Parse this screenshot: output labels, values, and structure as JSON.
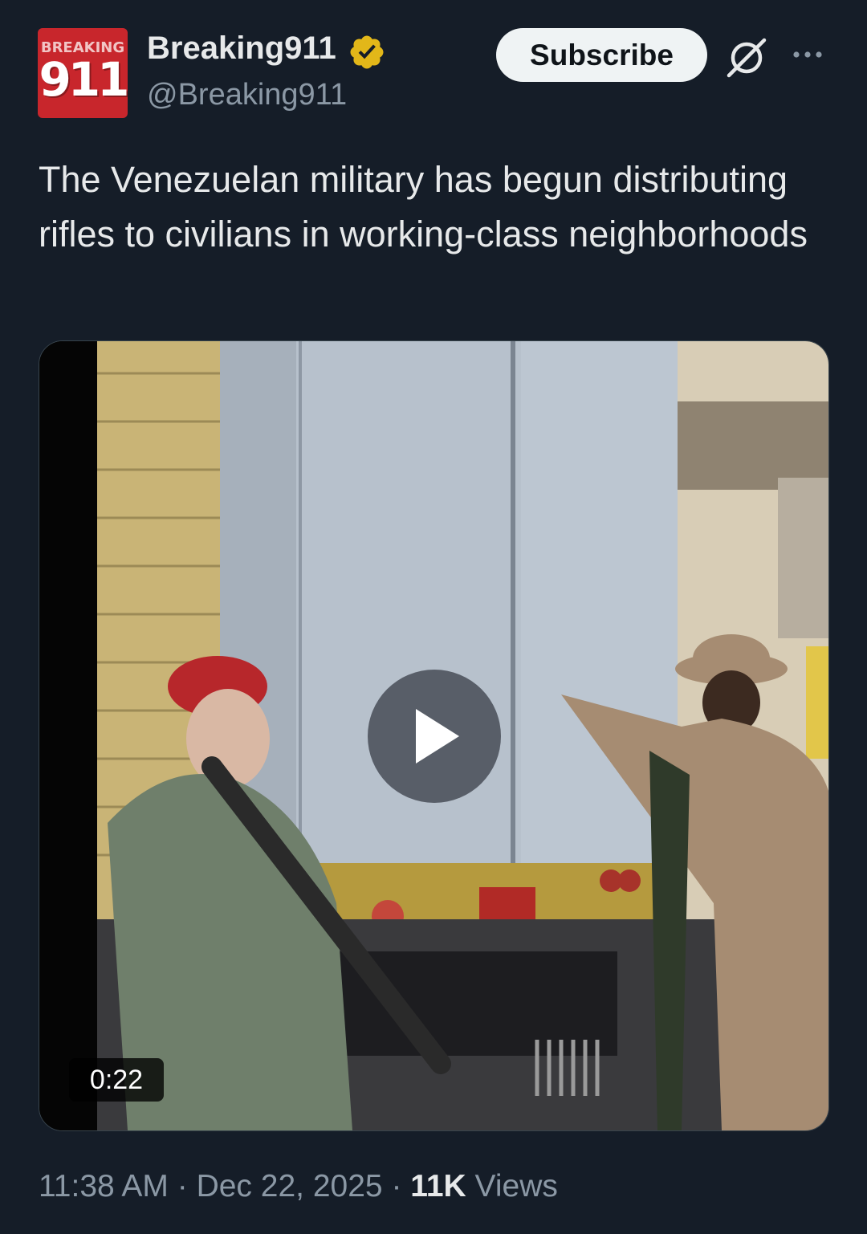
{
  "author": {
    "avatar_top_text": "BREAKING",
    "avatar_number": "911",
    "display_name": "Breaking911",
    "handle": "@Breaking911",
    "verified_color": "#e2b719"
  },
  "actions": {
    "subscribe_label": "Subscribe",
    "grok_icon": "grok-icon",
    "more_icon": "more-icon"
  },
  "tweet": {
    "text": "The Venezuelan military has begun distributing rifles to civilians in working-class neighborhoods"
  },
  "media": {
    "type": "video",
    "duration": "0:22",
    "play_icon": "play-icon"
  },
  "footer": {
    "time": "11:38 AM",
    "separator": "·",
    "date": "Dec 22, 2025",
    "views_count": "11K",
    "views_label": "Views"
  },
  "colors": {
    "background": "#151d28",
    "text_primary": "#e7e9ea",
    "text_secondary": "#8b98a5",
    "subscribe_bg": "#eff3f4"
  }
}
